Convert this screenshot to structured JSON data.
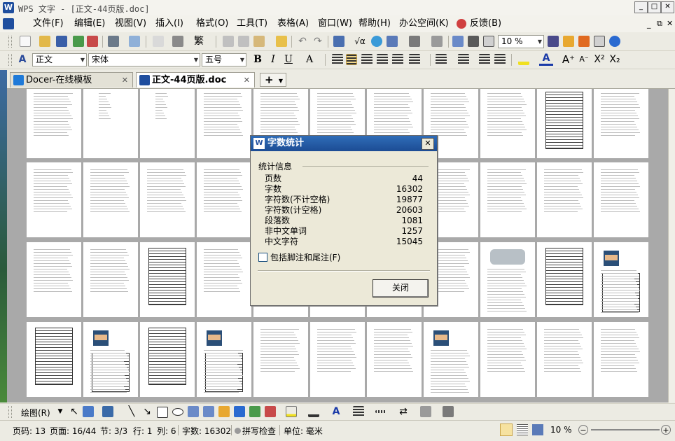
{
  "window": {
    "title": "WPS 文字 - [正文-44页版.doc]",
    "app_logo": "W",
    "controls": [
      "_",
      "□",
      "✕"
    ]
  },
  "menubar": {
    "items": [
      "文件(F)",
      "编辑(E)",
      "视图(V)",
      "插入(I)",
      "格式(O)",
      "工具(T)",
      "表格(A)",
      "窗口(W)",
      "帮助(H)",
      "办公空间(K)",
      "反馈(B)"
    ],
    "doc_controls": [
      "_",
      "⧉",
      "✕"
    ]
  },
  "standard_toolbar": {
    "zoom_value": "10 %"
  },
  "format_toolbar": {
    "style_value": "正文",
    "font_value": "宋体",
    "size_value": "五号",
    "bold": "B",
    "italic": "I",
    "underline": "U",
    "char_a": "A"
  },
  "tabs": [
    {
      "label": "Docer-在线模板",
      "active": false
    },
    {
      "label": "正文-44页版.doc",
      "active": true
    }
  ],
  "new_tab_label": "+",
  "dialog": {
    "title": "字数统计",
    "logo": "W",
    "group_label": "统计信息",
    "stats": [
      {
        "label": "页数",
        "value": "44"
      },
      {
        "label": "字数",
        "value": "16302"
      },
      {
        "label": "字符数(不计空格)",
        "value": "19877"
      },
      {
        "label": "字符数(计空格)",
        "value": "20603"
      },
      {
        "label": "段落数",
        "value": "1081"
      },
      {
        "label": "非中文单词",
        "value": "1257"
      },
      {
        "label": "中文字符",
        "value": "15045"
      }
    ],
    "checkbox_label": "包括脚注和尾注(F)",
    "checkbox_checked": false,
    "close_button": "关闭",
    "close_icon": "✕"
  },
  "drawing_toolbar": {
    "draw_label": "绘图(R)"
  },
  "statusbar": {
    "page_number": "页码: 13",
    "page_of": "页面: 16/44",
    "section": "节: 3/3",
    "row": "行: 1",
    "column": "列: 6",
    "word_count": "字数: 16302",
    "spell_check": "拼写检查",
    "unit": "单位: 毫米",
    "zoom": "10 %"
  },
  "colors": {
    "title_bar_accent": "#1f4e9e",
    "dialog_title_bg": "#2f6db8",
    "workspace_bg": "#a9a9a9",
    "chrome_bg": "#ecebe3"
  }
}
